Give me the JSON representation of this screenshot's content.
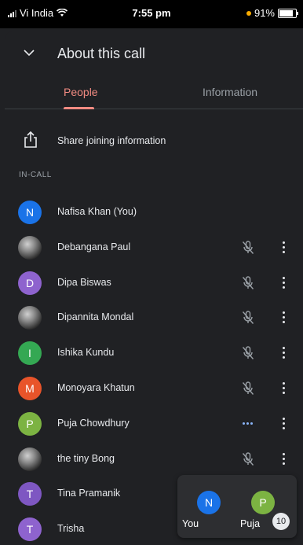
{
  "status": {
    "carrier": "Vi India",
    "time": "7:55 pm",
    "battery": "91%",
    "battery_level": 0.91
  },
  "header": {
    "title": "About this call"
  },
  "tabs": [
    {
      "label": "People",
      "active": true
    },
    {
      "label": "Information",
      "active": false
    }
  ],
  "share": {
    "label": "Share joining information"
  },
  "section": {
    "label": "IN-CALL"
  },
  "participants": [
    {
      "name": "Nafisa Khan (You)",
      "initial": "N",
      "color": "#1a73e8",
      "status": "none",
      "has_menu": false
    },
    {
      "name": "Debangana Paul",
      "initial": "",
      "color": "#5f6368",
      "photo": true,
      "status": "muted",
      "has_menu": true
    },
    {
      "name": "Dipa Biswas",
      "initial": "D",
      "color": "#8e63ce",
      "status": "muted",
      "has_menu": true
    },
    {
      "name": "Dipannita Mondal",
      "initial": "",
      "color": "#7a7a7a",
      "photo": true,
      "status": "muted",
      "has_menu": true
    },
    {
      "name": "Ishika Kundu",
      "initial": "I",
      "color": "#34a853",
      "status": "muted",
      "has_menu": true
    },
    {
      "name": "Monoyara Khatun",
      "initial": "M",
      "color": "#e8542a",
      "status": "muted",
      "has_menu": true
    },
    {
      "name": "Puja Chowdhury",
      "initial": "P",
      "color": "#7cb342",
      "status": "speaking",
      "has_menu": true
    },
    {
      "name": "the tiny Bong",
      "initial": "",
      "color": "#6a3fa0",
      "photo": true,
      "status": "muted",
      "has_menu": true
    },
    {
      "name": "Tina Pramanik",
      "initial": "T",
      "color": "#7e57c2",
      "status": "none",
      "has_menu": false
    },
    {
      "name": "Trisha",
      "initial": "T",
      "color": "#8e63ce",
      "status": "none",
      "has_menu": false
    }
  ],
  "pip": {
    "you": {
      "initial": "N",
      "label": "You",
      "color": "#1a73e8"
    },
    "other": {
      "initial": "P",
      "label": "Puja",
      "color": "#7cb342"
    },
    "count": "10"
  }
}
